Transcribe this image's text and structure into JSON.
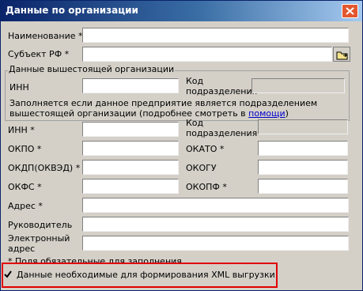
{
  "window": {
    "title": "Данные по организации",
    "close_icon": "close-icon"
  },
  "fields": {
    "name_label": "Наименование *",
    "subject_label": "Субъект РФ *",
    "subject_button_icon": "folder-browse-icon",
    "parent_group": {
      "title": "Данные вышестоящей организации",
      "inn_label": "ИНН",
      "code_label": "Код подразделения",
      "hint_text": "Заполняется если данное предприятие является подразделением вышестоящей организации (подробнее смотреть в",
      "hint_link": "помощи",
      "hint_end": ")"
    },
    "inn_label": "ИНН *",
    "code_label": "Код подразделения",
    "okpo_label": "ОКПО *",
    "okato_label": "ОКАТО *",
    "okdp_label": "ОКДП(ОКВЭД) *",
    "okogu_label": "ОКОГУ",
    "okfs_label": "ОКФС *",
    "okopf_label": "ОКОПФ *",
    "address_label": "Адрес *",
    "head_label": "Руководитель",
    "email_label": "Электронный адрес"
  },
  "footer": {
    "required_note": "* Поля обязательные для заполнения",
    "xml_checkbox_label": "Данные необходимые для формирования XML выгрузки",
    "xml_checkbox_checked": true
  },
  "colors": {
    "title_gradient_start": "#0a246a",
    "title_gradient_end": "#a6caf0",
    "close_button": "#e4572e",
    "highlight_border": "#e00000",
    "link": "#0000cc"
  }
}
